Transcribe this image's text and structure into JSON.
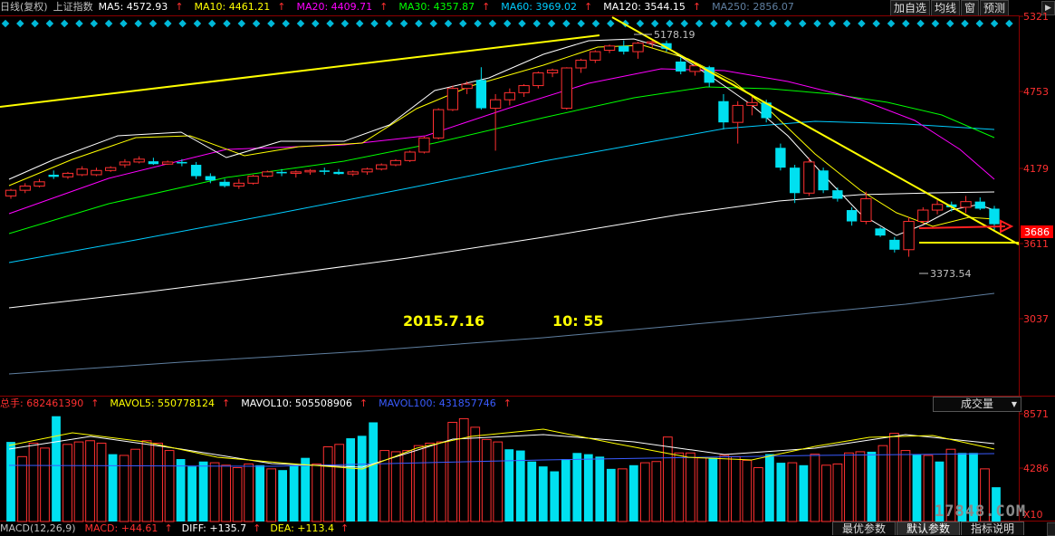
{
  "header": {
    "period": "日线(复权)",
    "symbol": "上证指数",
    "ma": [
      {
        "label": "MA5: 4572.93",
        "color": "#ffffff"
      },
      {
        "label": "MA10: 4461.21",
        "color": "#ffff00"
      },
      {
        "label": "MA20: 4409.71",
        "color": "#ff00ff"
      },
      {
        "label": "MA30: 4357.87",
        "color": "#00ff00"
      },
      {
        "label": "MA60: 3969.02",
        "color": "#00ccff"
      },
      {
        "label": "MA120: 3544.15",
        "color": "#ffffff"
      },
      {
        "label": "MA250: 2856.07",
        "color": "#5f7fa0"
      }
    ],
    "up_arrow": "↑",
    "buttons": [
      "加自选",
      "均线",
      "窗",
      "预测"
    ],
    "scroll_arrow": "▶"
  },
  "price_axis": {
    "labels": [
      "5321",
      "4753",
      "4179",
      "3611",
      "3037"
    ],
    "current": "3686",
    "current_color": "#ff0000"
  },
  "annotations": {
    "high": "5178.19",
    "low": "3373.54",
    "datetime_date": "2015.7.16",
    "datetime_time": "10:  55"
  },
  "volume_panel": {
    "legend": [
      {
        "label": "总手: 682461390",
        "color": "#ff3030"
      },
      {
        "label": "MAVOL5: 550778124",
        "color": "#ffff00"
      },
      {
        "label": "MAVOL10: 505508906",
        "color": "#ffffff"
      },
      {
        "label": "MAVOL100: 431857746",
        "color": "#3a5bff"
      }
    ],
    "selector": "成交量",
    "axis": [
      "8571",
      "4286"
    ],
    "axis_bottom": "X10"
  },
  "macd_panel": {
    "legend": [
      {
        "label": "MACD(12,26,9)",
        "color": "#c0c0c0"
      },
      {
        "label": "MACD: +44.61",
        "color": "#ff3030"
      },
      {
        "label": "DIFF: +135.7",
        "color": "#ffffff"
      },
      {
        "label": "DEA: +113.4",
        "color": "#ffff00"
      }
    ],
    "tabs": [
      "最优参数",
      "默认参数",
      "指标说明"
    ]
  },
  "watermark": "17848.COM",
  "chart_data": {
    "type": "candlestick",
    "ylim": [
      2700,
      5350
    ],
    "candles": [
      {
        "o": 4080,
        "h": 4130,
        "l": 4060,
        "c": 4120
      },
      {
        "o": 4120,
        "h": 4170,
        "l": 4100,
        "c": 4150
      },
      {
        "o": 4150,
        "h": 4200,
        "l": 4140,
        "c": 4180
      },
      {
        "o": 4230,
        "h": 4260,
        "l": 4200,
        "c": 4215
      },
      {
        "o": 4215,
        "h": 4250,
        "l": 4200,
        "c": 4240
      },
      {
        "o": 4230,
        "h": 4290,
        "l": 4220,
        "c": 4270
      },
      {
        "o": 4230,
        "h": 4280,
        "l": 4220,
        "c": 4260
      },
      {
        "o": 4260,
        "h": 4290,
        "l": 4250,
        "c": 4280
      },
      {
        "o": 4300,
        "h": 4340,
        "l": 4280,
        "c": 4320
      },
      {
        "o": 4320,
        "h": 4360,
        "l": 4310,
        "c": 4340
      },
      {
        "o": 4325,
        "h": 4350,
        "l": 4300,
        "c": 4305
      },
      {
        "o": 4305,
        "h": 4330,
        "l": 4300,
        "c": 4320
      },
      {
        "o": 4320,
        "h": 4340,
        "l": 4290,
        "c": 4310
      },
      {
        "o": 4300,
        "h": 4320,
        "l": 4200,
        "c": 4220
      },
      {
        "o": 4220,
        "h": 4240,
        "l": 4170,
        "c": 4190
      },
      {
        "o": 4180,
        "h": 4200,
        "l": 4140,
        "c": 4150
      },
      {
        "o": 4150,
        "h": 4200,
        "l": 4130,
        "c": 4170
      },
      {
        "o": 4170,
        "h": 4230,
        "l": 4160,
        "c": 4220
      },
      {
        "o": 4220,
        "h": 4260,
        "l": 4210,
        "c": 4250
      },
      {
        "o": 4250,
        "h": 4270,
        "l": 4220,
        "c": 4240
      },
      {
        "o": 4240,
        "h": 4260,
        "l": 4210,
        "c": 4250
      },
      {
        "o": 4250,
        "h": 4270,
        "l": 4230,
        "c": 4260
      },
      {
        "o": 4260,
        "h": 4280,
        "l": 4230,
        "c": 4250
      },
      {
        "o": 4250,
        "h": 4270,
        "l": 4230,
        "c": 4235
      },
      {
        "o": 4235,
        "h": 4260,
        "l": 4220,
        "c": 4250
      },
      {
        "o": 4250,
        "h": 4280,
        "l": 4230,
        "c": 4270
      },
      {
        "o": 4270,
        "h": 4310,
        "l": 4260,
        "c": 4300
      },
      {
        "o": 4300,
        "h": 4340,
        "l": 4290,
        "c": 4330
      },
      {
        "o": 4330,
        "h": 4400,
        "l": 4320,
        "c": 4390
      },
      {
        "o": 4390,
        "h": 4500,
        "l": 4380,
        "c": 4490
      },
      {
        "o": 4490,
        "h": 4700,
        "l": 4480,
        "c": 4690
      },
      {
        "o": 4690,
        "h": 4860,
        "l": 4680,
        "c": 4840
      },
      {
        "o": 4840,
        "h": 4890,
        "l": 4800,
        "c": 4870
      },
      {
        "o": 4900,
        "h": 4990,
        "l": 4690,
        "c": 4700
      },
      {
        "o": 4700,
        "h": 4800,
        "l": 4400,
        "c": 4760
      },
      {
        "o": 4760,
        "h": 4840,
        "l": 4720,
        "c": 4810
      },
      {
        "o": 4810,
        "h": 4870,
        "l": 4780,
        "c": 4860
      },
      {
        "o": 4860,
        "h": 4960,
        "l": 4840,
        "c": 4950
      },
      {
        "o": 4950,
        "h": 4980,
        "l": 4920,
        "c": 4970
      },
      {
        "o": 4700,
        "h": 4990,
        "l": 4690,
        "c": 4985
      },
      {
        "o": 4985,
        "h": 5050,
        "l": 4950,
        "c": 5040
      },
      {
        "o": 5040,
        "h": 5110,
        "l": 5020,
        "c": 5100
      },
      {
        "o": 5110,
        "h": 5150,
        "l": 5090,
        "c": 5140
      },
      {
        "o": 5140,
        "h": 5180,
        "l": 5080,
        "c": 5100
      },
      {
        "o": 5100,
        "h": 5170,
        "l": 5050,
        "c": 5160
      },
      {
        "o": 5160,
        "h": 5178,
        "l": 5130,
        "c": 5170
      },
      {
        "o": 5160,
        "h": 5178,
        "l": 5100,
        "c": 5120
      },
      {
        "o": 5030,
        "h": 5060,
        "l": 4940,
        "c": 4960
      },
      {
        "o": 4960,
        "h": 5030,
        "l": 4930,
        "c": 5000
      },
      {
        "o": 4990,
        "h": 5000,
        "l": 4850,
        "c": 4880
      },
      {
        "o": 4750,
        "h": 4800,
        "l": 4550,
        "c": 4600
      },
      {
        "o": 4600,
        "h": 4750,
        "l": 4450,
        "c": 4720
      },
      {
        "o": 4720,
        "h": 4780,
        "l": 4650,
        "c": 4740
      },
      {
        "o": 4740,
        "h": 4760,
        "l": 4600,
        "c": 4630
      },
      {
        "o": 4420,
        "h": 4450,
        "l": 4260,
        "c": 4280
      },
      {
        "o": 4280,
        "h": 4300,
        "l": 4030,
        "c": 4100
      },
      {
        "o": 4100,
        "h": 4350,
        "l": 4080,
        "c": 4320
      },
      {
        "o": 4260,
        "h": 4280,
        "l": 4100,
        "c": 4120
      },
      {
        "o": 4120,
        "h": 4140,
        "l": 4040,
        "c": 4060
      },
      {
        "o": 3980,
        "h": 4000,
        "l": 3870,
        "c": 3900
      },
      {
        "o": 3900,
        "h": 4110,
        "l": 3880,
        "c": 4060
      },
      {
        "o": 3850,
        "h": 3860,
        "l": 3790,
        "c": 3800
      },
      {
        "o": 3770,
        "h": 3790,
        "l": 3680,
        "c": 3700
      },
      {
        "o": 3700,
        "h": 3930,
        "l": 3650,
        "c": 3900
      },
      {
        "o": 3900,
        "h": 4000,
        "l": 3880,
        "c": 3980
      },
      {
        "o": 3980,
        "h": 4050,
        "l": 3950,
        "c": 4020
      },
      {
        "o": 4020,
        "h": 4040,
        "l": 3970,
        "c": 4000
      },
      {
        "o": 4000,
        "h": 4080,
        "l": 3960,
        "c": 4040
      },
      {
        "o": 4040,
        "h": 4070,
        "l": 3980,
        "c": 3990
      },
      {
        "o": 3990,
        "h": 4010,
        "l": 3830,
        "c": 3880
      }
    ],
    "volume": [
      6.5,
      5.3,
      6.4,
      6.0,
      8.6,
      6.3,
      6.5,
      6.6,
      6.4,
      5.5,
      5.4,
      5.9,
      6.6,
      6.4,
      5.8,
      5.1,
      4.5,
      4.9,
      4.8,
      4.6,
      4.4,
      4.7,
      4.6,
      4.3,
      4.2,
      4.6,
      5.2,
      4.7,
      6.1,
      6.3,
      6.8,
      7.0,
      8.1,
      5.8,
      5.7,
      5.8,
      6.2,
      6.4,
      6.5,
      8.1,
      8.4,
      7.7,
      6.7,
      6.5,
      5.9,
      5.8,
      4.9,
      4.5,
      4.1,
      5.1,
      5.6,
      5.5,
      5.3,
      4.3,
      4.3,
      4.6,
      4.8,
      4.9,
      6.9,
      5.6,
      5.6,
      5.2,
      5.2,
      5.4,
      5.3,
      5.0,
      4.4,
      5.5,
      4.8,
      4.8,
      4.6,
      5.5,
      4.6,
      4.7,
      5.6,
      5.7,
      5.7,
      6.2,
      7.2,
      5.8,
      5.5,
      5.4,
      4.9,
      5.9,
      5.6,
      5.6,
      4.3,
      2.8
    ]
  }
}
